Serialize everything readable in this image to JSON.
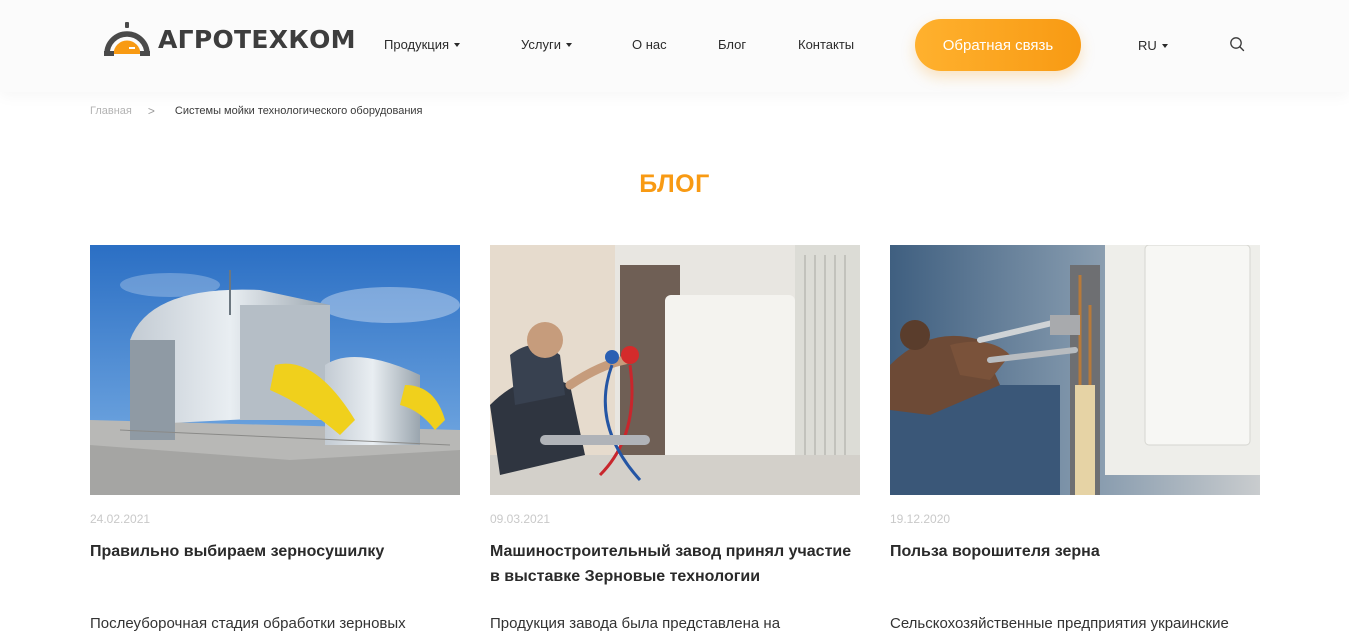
{
  "logo": {
    "text": "АГРОТЕХКОМ"
  },
  "nav": {
    "products": "Продукция",
    "services": "Услуги",
    "about": "О нас",
    "blog": "Блог",
    "contacts": "Контакты"
  },
  "cta_label": "Обратная связь",
  "language": "RU",
  "breadcrumb": {
    "home": "Главная",
    "separator": ">",
    "current": "Системы мойки технологического оборудования"
  },
  "page_title": "БЛОГ",
  "posts": [
    {
      "date": "24.02.2021",
      "title": "Правильно выбираем зерносушилку",
      "excerpt": "Послеуборочная стадия обработки зерновых"
    },
    {
      "date": "09.03.2021",
      "title": "Машиностроительный завод принял участие в выставке Зерновые технологии",
      "excerpt": "Продукция завода была представлена на"
    },
    {
      "date": "19.12.2020",
      "title": "Польза ворошителя зерна",
      "excerpt": "Сельскохозяйственные предприятия украинские"
    }
  ],
  "colors": {
    "accent": "#f89a13",
    "accent_light": "#ffb12e",
    "text": "#2a2a2a",
    "muted": "#c9c9c9"
  },
  "icons": [
    "logo-dome-icon",
    "caret-down-icon",
    "search-icon",
    "chevron-right-icon"
  ]
}
